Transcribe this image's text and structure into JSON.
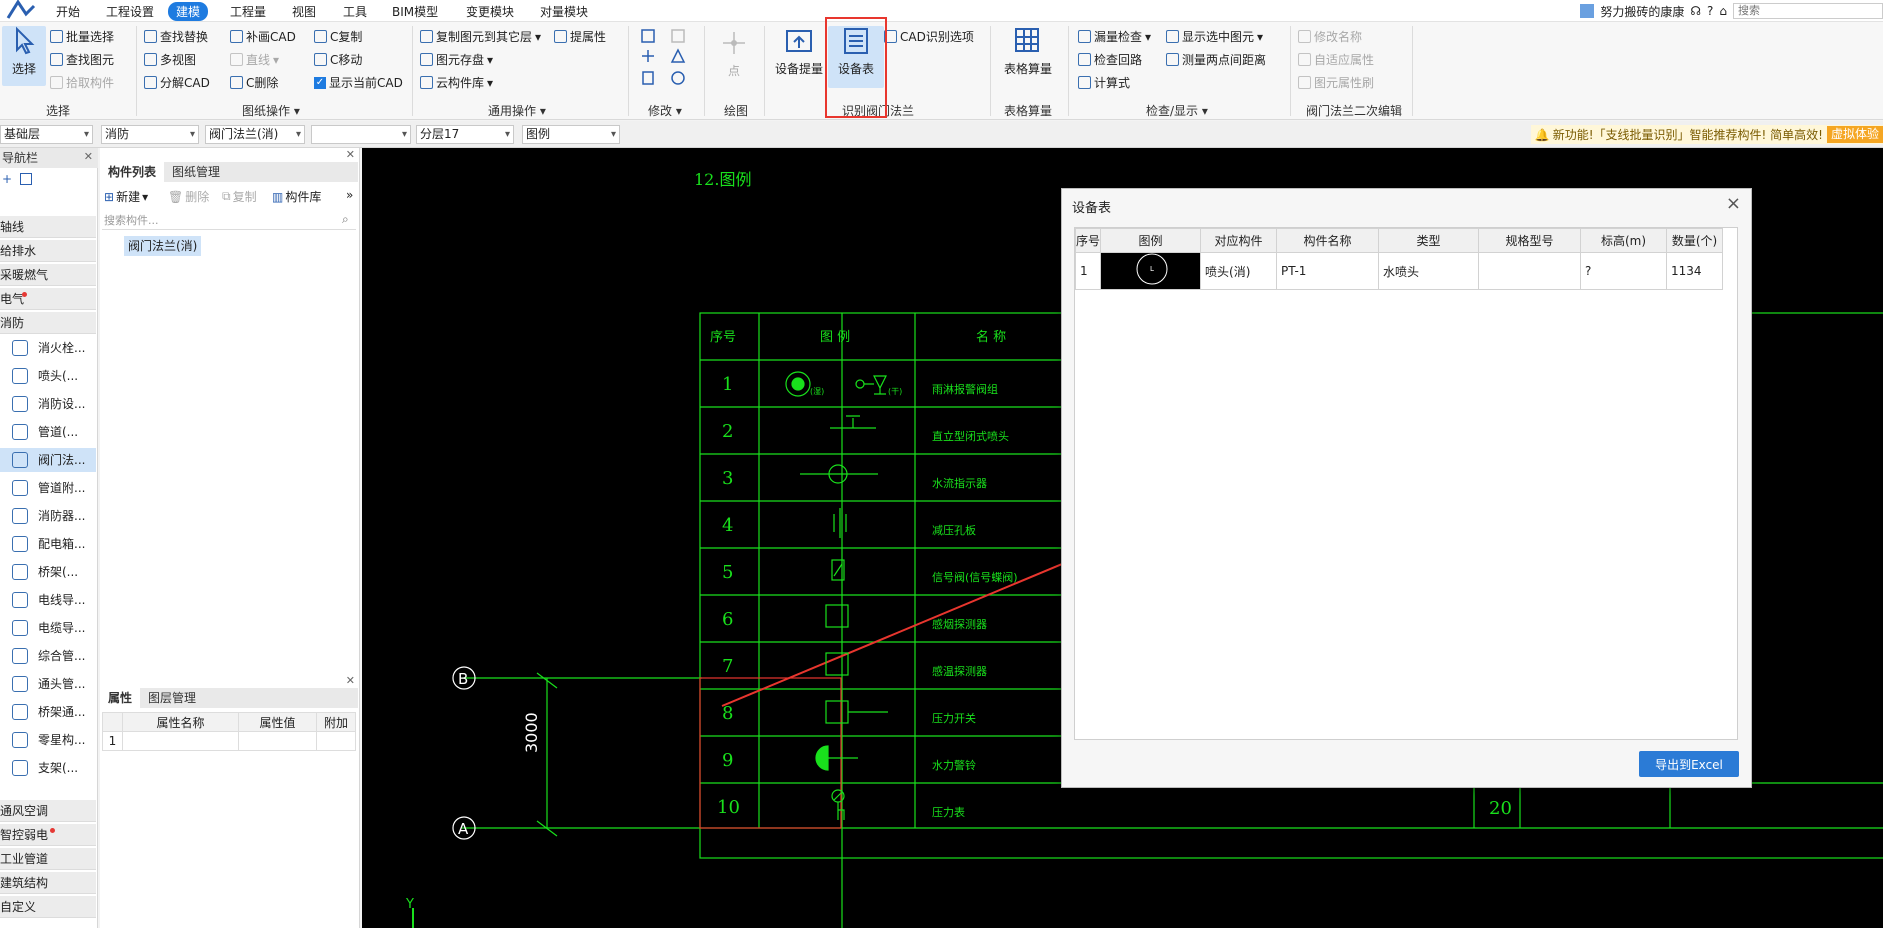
{
  "menu": [
    "开始",
    "工程设置",
    "建模",
    "工程量",
    "视图",
    "工具",
    "BIM模型",
    "变更模块",
    "对量模块"
  ],
  "menu_active_index": 2,
  "user": {
    "name": "努力搬砖的康康",
    "help": "?",
    "search_placeholder": "搜索"
  },
  "ribbon": {
    "select_group": {
      "label": "选择",
      "select": "选择",
      "items": [
        "批量选择",
        "查找图元",
        "拾取构件"
      ]
    },
    "drawing_group": {
      "label": "图纸操作",
      "items": [
        "查找替换",
        "多视图",
        "分解CAD",
        "补画CAD",
        "直线",
        "C删除",
        "C复制",
        "C移动",
        "显示当前CAD"
      ]
    },
    "general_group": {
      "label": "通用操作",
      "items": [
        "复制图元到其它层",
        "图元存盘",
        "云构件库",
        "提属性"
      ]
    },
    "modify_group": {
      "label": "修改"
    },
    "draw_group": {
      "label": "绘图",
      "point": "点"
    },
    "recog_group": {
      "label": "识别阀门法兰",
      "equip_lift": "设备提量",
      "equip_table": "设备表",
      "cad_options": "CAD识别选项"
    },
    "table_group": {
      "label": "表格算量",
      "table_calc": "表格算量"
    },
    "check_group": {
      "label": "检查/显示",
      "items": [
        "漏量检查",
        "显示选中图元",
        "检查回路",
        "测量两点间距离",
        "计算式"
      ]
    },
    "valve_group": {
      "label": "阀门法兰二次编辑",
      "items": [
        "修改名称",
        "自适应属性",
        "图元属性刷"
      ]
    }
  },
  "options": {
    "layer": "基础层",
    "discipline": "消防",
    "type": "阀门法兰(消)",
    "blank": "",
    "sublayer": "分层17",
    "legend": "图例"
  },
  "notice": {
    "text": "新功能!「支线批量识别」智能推荐构件! 简单高效!",
    "tag": "虚拟体验"
  },
  "nav": {
    "title": "导航栏",
    "cats": [
      "轴线",
      "给排水",
      "采暖燃气",
      "电气",
      "消防"
    ],
    "items": [
      "消火栓...",
      "喷头(...",
      "消防设...",
      "管道(...",
      "阀门法...",
      "管道附...",
      "消防器...",
      "配电箱...",
      "桥架(...",
      "电线导...",
      "电缆导...",
      "综合管...",
      "通头管...",
      "桥架通...",
      "零星构...",
      "支架(..."
    ],
    "cats_after": [
      "通风空调",
      "智控弱电",
      "工业管道",
      "建筑结构",
      "自定义"
    ]
  },
  "comp": {
    "tabs": [
      "构件列表",
      "图纸管理"
    ],
    "toolbar": {
      "new": "新建",
      "delete": "删除",
      "copy": "复制",
      "library": "构件库"
    },
    "search_placeholder": "搜索构件...",
    "item": "阀门法兰(消)",
    "prop_tabs": [
      "属性",
      "图层管理"
    ],
    "prop_headers": [
      "属性名称",
      "属性值",
      "附加"
    ],
    "prop_row_no": "1"
  },
  "cad": {
    "title": "12.图例",
    "header": {
      "no": "序号",
      "legend": "图 例",
      "name": "名 称"
    },
    "rows": [
      {
        "no": "1",
        "name": "雨淋报警阀组"
      },
      {
        "no": "2",
        "name": "直立型闭式喷头"
      },
      {
        "no": "3",
        "name": "水流指示器"
      },
      {
        "no": "4",
        "name": "减压孔板"
      },
      {
        "no": "5",
        "name": "信号阀(信号蝶阀)"
      },
      {
        "no": "6",
        "name": "感烟探测器"
      },
      {
        "no": "7",
        "name": "感温探测器"
      },
      {
        "no": "8",
        "name": "压力开关"
      },
      {
        "no": "9",
        "name": "水力警铃"
      },
      {
        "no": "10",
        "name": "压力表"
      }
    ],
    "row10_value": "20",
    "axis_b": "B",
    "axis_a": "A",
    "dim": "3000",
    "y_label": "Y",
    "legend1_sub1": "(湿)",
    "legend1_sub2": "(干)"
  },
  "dialog": {
    "title": "设备表",
    "headers": [
      "序号",
      "图例",
      "对应构件",
      "构件名称",
      "类型",
      "规格型号",
      "标高(m)",
      "数量(个)"
    ],
    "rows": [
      {
        "no": "1",
        "component": "喷头(消)",
        "name": "PT-1",
        "type": "水喷头",
        "spec": "",
        "elevation": "?",
        "qty": "1134"
      }
    ],
    "export": "导出到Excel"
  },
  "colors": {
    "accent": "#1e7be0",
    "cad_green": "#19e01c",
    "highlight": "#e8362e",
    "dialog_btn": "#2b7bd6"
  }
}
